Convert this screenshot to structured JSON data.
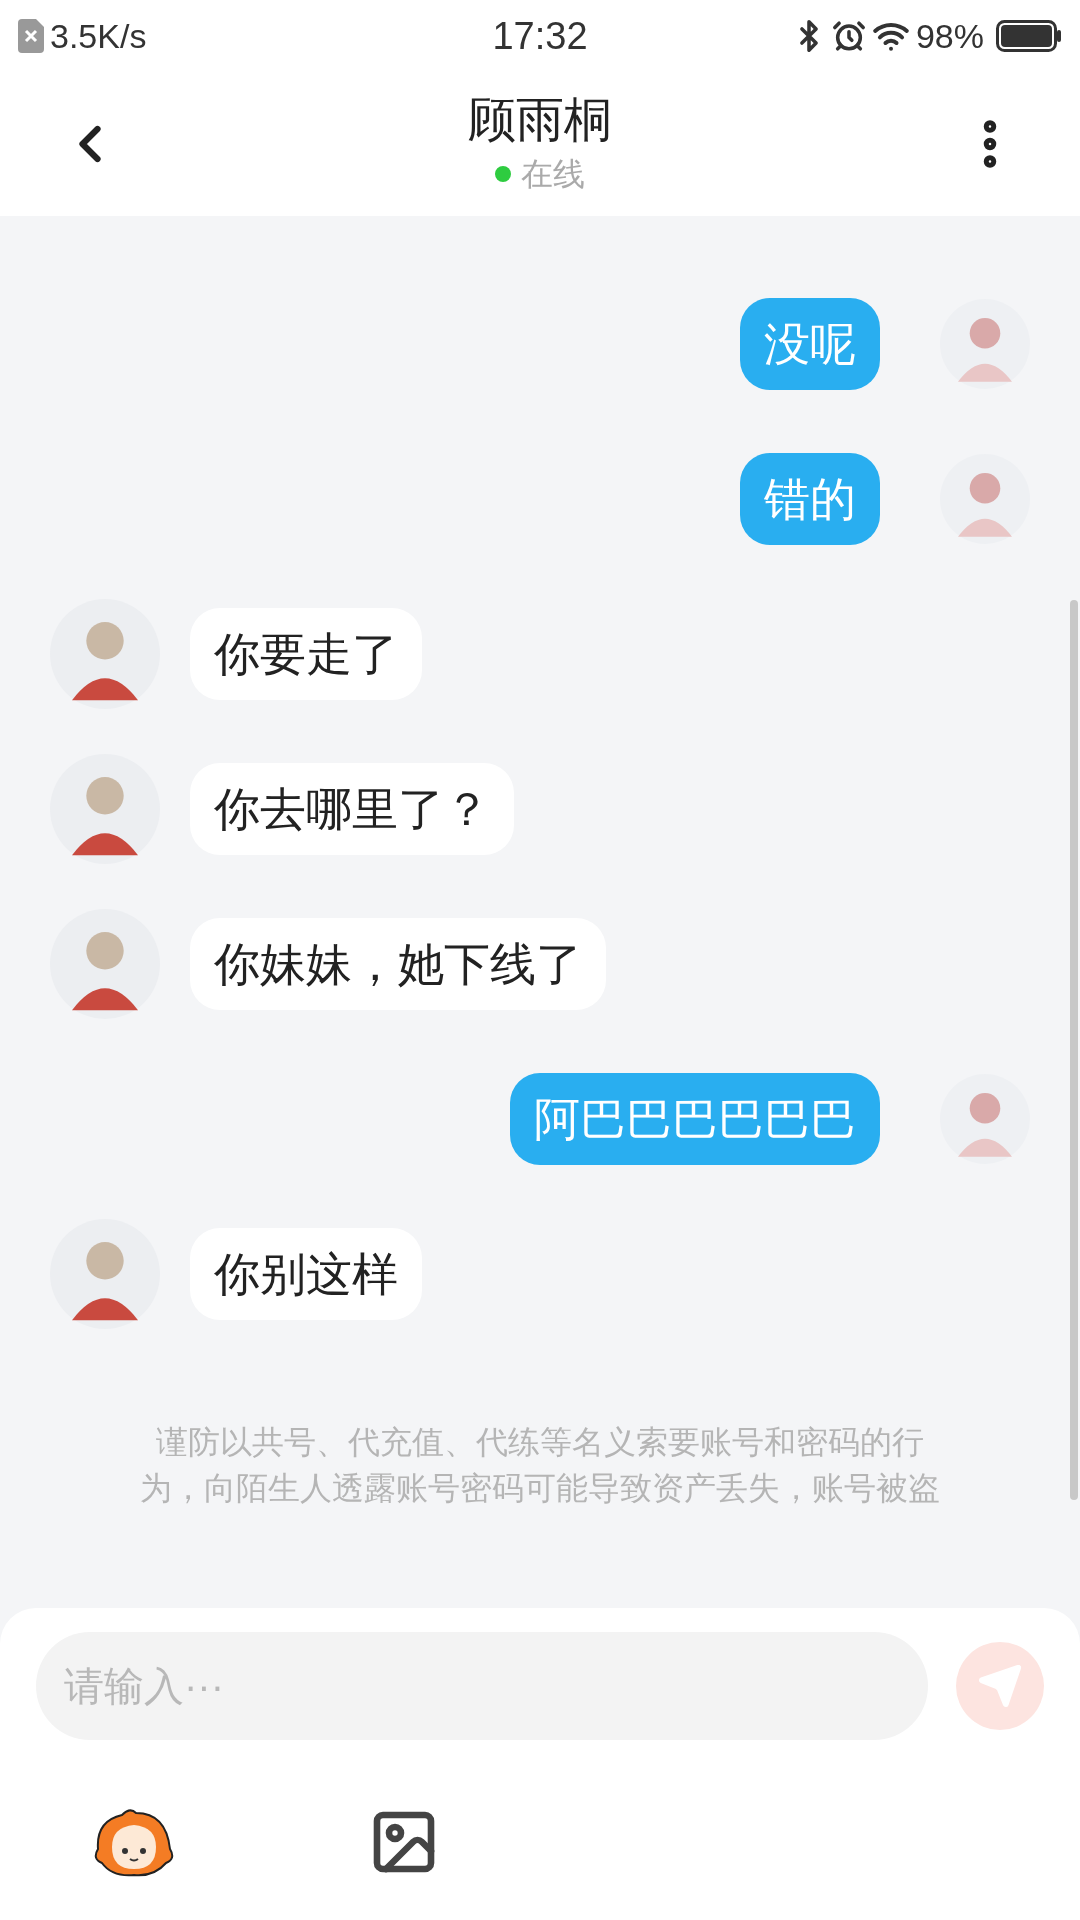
{
  "status_bar": {
    "speed": "3.5K/s",
    "time": "17:32",
    "battery": "98%"
  },
  "header": {
    "title": "顾雨桐",
    "status": "在线",
    "online": true
  },
  "messages": [
    {
      "kind": "sent",
      "text": "没呢"
    },
    {
      "kind": "sent",
      "text": "错的"
    },
    {
      "kind": "received",
      "text": "你要走了"
    },
    {
      "kind": "received",
      "text": "你去哪里了？"
    },
    {
      "kind": "received",
      "text": "你妹妹，她下线了"
    },
    {
      "kind": "sent",
      "text": "阿巴巴巴巴巴巴"
    },
    {
      "kind": "received",
      "text": "你别这样"
    }
  ],
  "notice": "谨防以共号、代充值、代练等名义索要账号和密码的行为，向陌生人透露账号密码可能导致资产丢失，账号被盗",
  "composer": {
    "placeholder": "请输入···",
    "send_disabled": true
  }
}
